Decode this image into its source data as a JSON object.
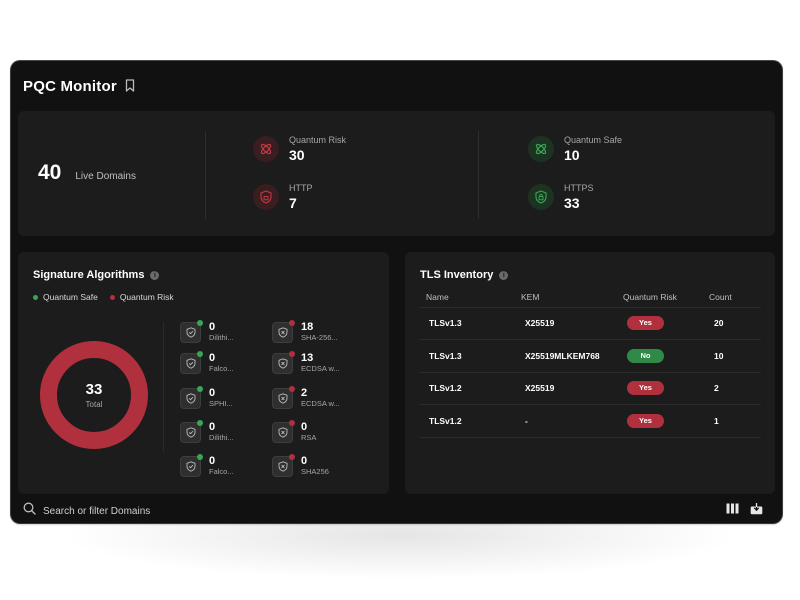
{
  "app": {
    "title": "PQC Monitor"
  },
  "stats": {
    "live_count": "40",
    "live_label": "Live Domains",
    "quantum_risk": {
      "label": "Quantum Risk",
      "value": "30",
      "icon": "quantum-risk-icon",
      "color": "#b0313d"
    },
    "http": {
      "label": "HTTP",
      "value": "7",
      "icon": "unlocked-shield-icon",
      "color": "#b0313d"
    },
    "quantum_safe": {
      "label": "Quantum Safe",
      "value": "10",
      "icon": "quantum-safe-icon",
      "color": "#3aa655"
    },
    "https": {
      "label": "HTTPS",
      "value": "33",
      "icon": "locked-shield-icon",
      "color": "#3aa655"
    }
  },
  "signature": {
    "title": "Signature Algorithms",
    "legend": {
      "safe": "Quantum Safe",
      "risk": "Quantum Risk"
    },
    "total": "33",
    "total_label": "Total",
    "colors": {
      "safe": "#3aa655",
      "risk": "#b0313d"
    },
    "safe_algos": [
      {
        "count": "0",
        "name": "Dilithi..."
      },
      {
        "count": "0",
        "name": "Falco..."
      },
      {
        "count": "0",
        "name": "SPHI..."
      },
      {
        "count": "0",
        "name": "Dilithi..."
      },
      {
        "count": "0",
        "name": "Falco..."
      }
    ],
    "risk_algos": [
      {
        "count": "18",
        "name": "SHA-256..."
      },
      {
        "count": "13",
        "name": "ECDSA w..."
      },
      {
        "count": "2",
        "name": "ECDSA w..."
      },
      {
        "count": "0",
        "name": "RSA"
      },
      {
        "count": "0",
        "name": "SHA256"
      }
    ]
  },
  "tls": {
    "title": "TLS Inventory",
    "columns": {
      "name": "Name",
      "kem": "KEM",
      "risk": "Quantum Risk",
      "count": "Count"
    },
    "rows": [
      {
        "name": "TLSv1.3",
        "kem": "X25519",
        "risk": "Yes",
        "count": "20"
      },
      {
        "name": "TLSv1.3",
        "kem": "X25519MLKEM768",
        "risk": "No",
        "count": "10"
      },
      {
        "name": "TLSv1.2",
        "kem": "X25519",
        "risk": "Yes",
        "count": "2"
      },
      {
        "name": "TLSv1.2",
        "kem": "-",
        "risk": "Yes",
        "count": "1"
      }
    ]
  },
  "footer": {
    "search_placeholder": "Search or filter Domains",
    "icons": [
      "columns-icon",
      "export-icon"
    ]
  }
}
